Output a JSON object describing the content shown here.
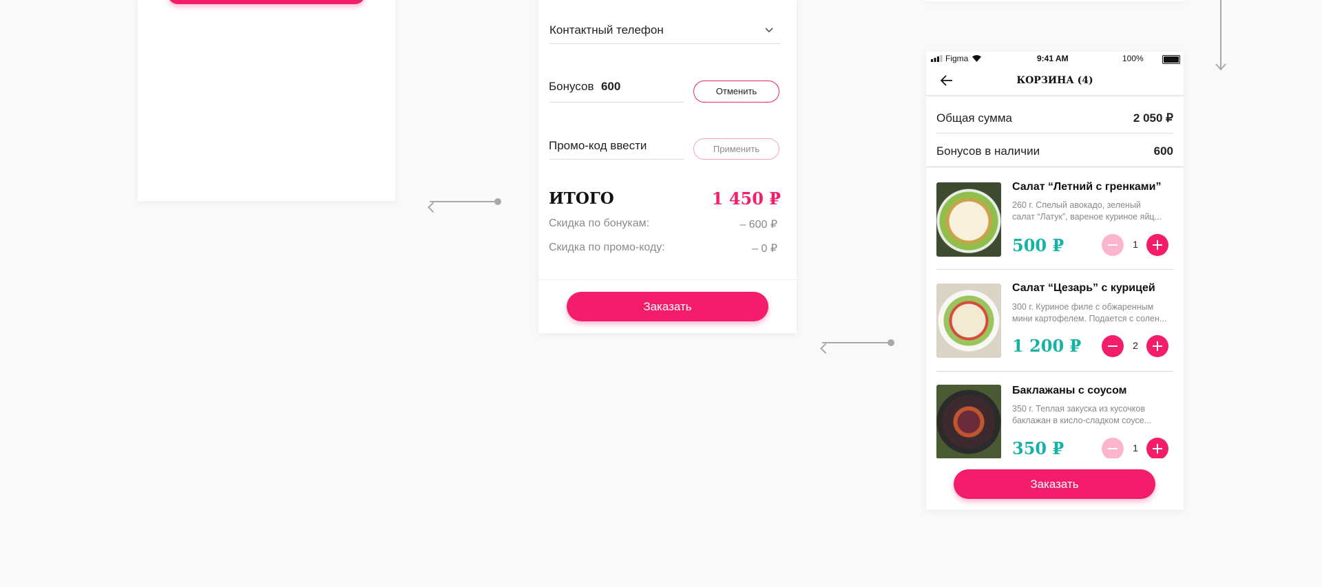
{
  "left_panel": {},
  "middle_panel": {
    "phone_label": "Контактный телефон",
    "bonus_label": "Бонусов",
    "bonus_value": "600",
    "cancel_label": "Отменить",
    "promo_placeholder": "Промо-код ввести",
    "apply_label": "Применить",
    "total_label": "ИТОГО",
    "total_value": "1 450 ₽",
    "bonus_discount_label": "Скидка по бонукам:",
    "bonus_discount_value": "– 600 ₽",
    "promo_discount_label": "Скидка по промо-коду:",
    "promo_discount_value": "– 0 ₽",
    "order_label": "Заказать"
  },
  "cart": {
    "status": {
      "carrier": "Figma",
      "time": "9:41 AM",
      "battery": "100%"
    },
    "title": "КОРЗИНА (4)",
    "sum_label": "Общая сумма",
    "sum_value": "2 050 ₽",
    "bonus_label": "Бонусов в наличии",
    "bonus_value": "600",
    "items": [
      {
        "name": "Салат “Летний с гренками”",
        "desc1": "260 г. Спелый авокадо, зеленый",
        "desc2": "салат “Латук”, вареное куриное яйц...",
        "price": "500 ₽",
        "qty": "1",
        "minus_disabled": true
      },
      {
        "name": "Салат “Цезарь” с курицей",
        "desc1": "300 г. Куриное филе с обжаренным",
        "desc2": "мини картофелем. Подается с солен...",
        "price": "1 200 ₽",
        "qty": "2",
        "minus_disabled": false
      },
      {
        "name": "Баклажаны с соусом",
        "desc1": "350 г. Теплая закуска из кусочков",
        "desc2": "баклажан в кисло-сладком соусе...",
        "price": "350 ₽",
        "qty": "1",
        "minus_disabled": true
      }
    ],
    "order_label": "Заказать"
  },
  "colors": {
    "accent": "#f31d6b",
    "price": "#16b3a5"
  }
}
